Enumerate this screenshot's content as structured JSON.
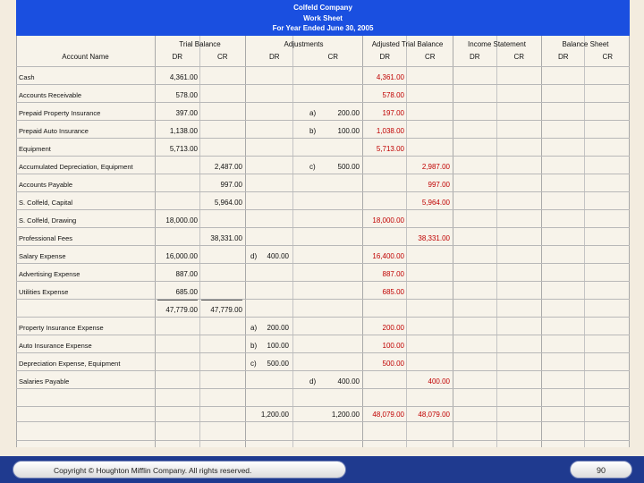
{
  "header": {
    "company": "Colfeld Company",
    "doc": "Work Sheet",
    "period": "For Year Ended June 30, 2005"
  },
  "columns": {
    "account_name": "Account Name",
    "groups": [
      "Trial Balance",
      "Adjustments",
      "Adjusted Trial Balance",
      "Income Statement",
      "Balance Sheet"
    ],
    "dr": "DR",
    "cr": "CR"
  },
  "rows": [
    {
      "account": "Cash",
      "tb_dr": "4,361.00",
      "tb_cr": "",
      "adj_dr_ref": "",
      "adj_dr": "",
      "adj_cr_ref": "",
      "adj_cr": "",
      "atb_dr": "4,361.00",
      "atb_cr": ""
    },
    {
      "account": "Accounts Receivable",
      "tb_dr": "578.00",
      "tb_cr": "",
      "adj_dr_ref": "",
      "adj_dr": "",
      "adj_cr_ref": "",
      "adj_cr": "",
      "atb_dr": "578.00",
      "atb_cr": ""
    },
    {
      "account": "Prepaid Property Insurance",
      "tb_dr": "397.00",
      "tb_cr": "",
      "adj_dr_ref": "",
      "adj_dr": "",
      "adj_cr_ref": "a)",
      "adj_cr": "200.00",
      "atb_dr": "197.00",
      "atb_cr": ""
    },
    {
      "account": "Prepaid Auto Insurance",
      "tb_dr": "1,138.00",
      "tb_cr": "",
      "adj_dr_ref": "",
      "adj_dr": "",
      "adj_cr_ref": "b)",
      "adj_cr": "100.00",
      "atb_dr": "1,038.00",
      "atb_cr": ""
    },
    {
      "account": "Equipment",
      "tb_dr": "5,713.00",
      "tb_cr": "",
      "adj_dr_ref": "",
      "adj_dr": "",
      "adj_cr_ref": "",
      "adj_cr": "",
      "atb_dr": "5,713.00",
      "atb_cr": ""
    },
    {
      "account": "Accumulated Depreciation, Equipment",
      "tb_dr": "",
      "tb_cr": "2,487.00",
      "adj_dr_ref": "",
      "adj_dr": "",
      "adj_cr_ref": "c)",
      "adj_cr": "500.00",
      "atb_dr": "",
      "atb_cr": "2,987.00"
    },
    {
      "account": "Accounts Payable",
      "tb_dr": "",
      "tb_cr": "997.00",
      "adj_dr_ref": "",
      "adj_dr": "",
      "adj_cr_ref": "",
      "adj_cr": "",
      "atb_dr": "",
      "atb_cr": "997.00"
    },
    {
      "account": "S. Colfeld, Capital",
      "tb_dr": "",
      "tb_cr": "5,964.00",
      "adj_dr_ref": "",
      "adj_dr": "",
      "adj_cr_ref": "",
      "adj_cr": "",
      "atb_dr": "",
      "atb_cr": "5,964.00"
    },
    {
      "account": "S. Colfeld, Drawing",
      "tb_dr": "18,000.00",
      "tb_cr": "",
      "adj_dr_ref": "",
      "adj_dr": "",
      "adj_cr_ref": "",
      "adj_cr": "",
      "atb_dr": "18,000.00",
      "atb_cr": ""
    },
    {
      "account": "Professional Fees",
      "tb_dr": "",
      "tb_cr": "38,331.00",
      "adj_dr_ref": "",
      "adj_dr": "",
      "adj_cr_ref": "",
      "adj_cr": "",
      "atb_dr": "",
      "atb_cr": "38,331.00"
    },
    {
      "account": "Salary Expense",
      "tb_dr": "16,000.00",
      "tb_cr": "",
      "adj_dr_ref": "d)",
      "adj_dr": "400.00",
      "adj_cr_ref": "",
      "adj_cr": "",
      "atb_dr": "16,400.00",
      "atb_cr": ""
    },
    {
      "account": "Advertising Expense",
      "tb_dr": "887.00",
      "tb_cr": "",
      "adj_dr_ref": "",
      "adj_dr": "",
      "adj_cr_ref": "",
      "adj_cr": "",
      "atb_dr": "887.00",
      "atb_cr": ""
    },
    {
      "account": "Utilities Expense",
      "tb_dr": "685.00",
      "tb_cr": "",
      "adj_dr_ref": "",
      "adj_dr": "",
      "adj_cr_ref": "",
      "adj_cr": "",
      "atb_dr": "685.00",
      "atb_cr": ""
    },
    {
      "account": "",
      "tb_dr": "47,779.00",
      "tb_cr": "47,779.00",
      "adj_dr_ref": "",
      "adj_dr": "",
      "adj_cr_ref": "",
      "adj_cr": "",
      "atb_dr": "",
      "atb_cr": ""
    },
    {
      "account": "Property Insurance Expense",
      "tb_dr": "",
      "tb_cr": "",
      "adj_dr_ref": "a)",
      "adj_dr": "200.00",
      "adj_cr_ref": "",
      "adj_cr": "",
      "atb_dr": "200.00",
      "atb_cr": ""
    },
    {
      "account": "Auto Insurance Expense",
      "tb_dr": "",
      "tb_cr": "",
      "adj_dr_ref": "b)",
      "adj_dr": "100.00",
      "adj_cr_ref": "",
      "adj_cr": "",
      "atb_dr": "100.00",
      "atb_cr": ""
    },
    {
      "account": "Depreciation Expense, Equipment",
      "tb_dr": "",
      "tb_cr": "",
      "adj_dr_ref": "c)",
      "adj_dr": "500.00",
      "adj_cr_ref": "",
      "adj_cr": "",
      "atb_dr": "500.00",
      "atb_cr": ""
    },
    {
      "account": "Salaries Payable",
      "tb_dr": "",
      "tb_cr": "",
      "adj_dr_ref": "",
      "adj_dr": "",
      "adj_cr_ref": "d)",
      "adj_cr": "400.00",
      "atb_dr": "",
      "atb_cr": "400.00"
    },
    {
      "account": "",
      "tb_dr": "",
      "tb_cr": "",
      "adj_dr_ref": "",
      "adj_dr": "",
      "adj_cr_ref": "",
      "adj_cr": "",
      "atb_dr": "",
      "atb_cr": ""
    },
    {
      "account": "",
      "tb_dr": "",
      "tb_cr": "",
      "adj_dr_ref": "",
      "adj_dr": "1,200.00",
      "adj_cr_ref": "",
      "adj_cr": "1,200.00",
      "atb_dr": "48,079.00",
      "atb_cr": "48,079.00"
    },
    {
      "account": "",
      "tb_dr": "",
      "tb_cr": "",
      "adj_dr_ref": "",
      "adj_dr": "",
      "adj_cr_ref": "",
      "adj_cr": "",
      "atb_dr": "",
      "atb_cr": ""
    },
    {
      "account": "",
      "tb_dr": "",
      "tb_cr": "",
      "adj_dr_ref": "",
      "adj_dr": "",
      "adj_cr_ref": "",
      "adj_cr": "",
      "atb_dr": "",
      "atb_cr": ""
    }
  ],
  "colors": {
    "banner": "#1a4fe0",
    "adjusted_text": "#c00000",
    "footer": "#1f3a8f"
  },
  "footer": {
    "copyright": "Copyright © Houghton Mifflin Company. All rights reserved.",
    "page": "90"
  }
}
